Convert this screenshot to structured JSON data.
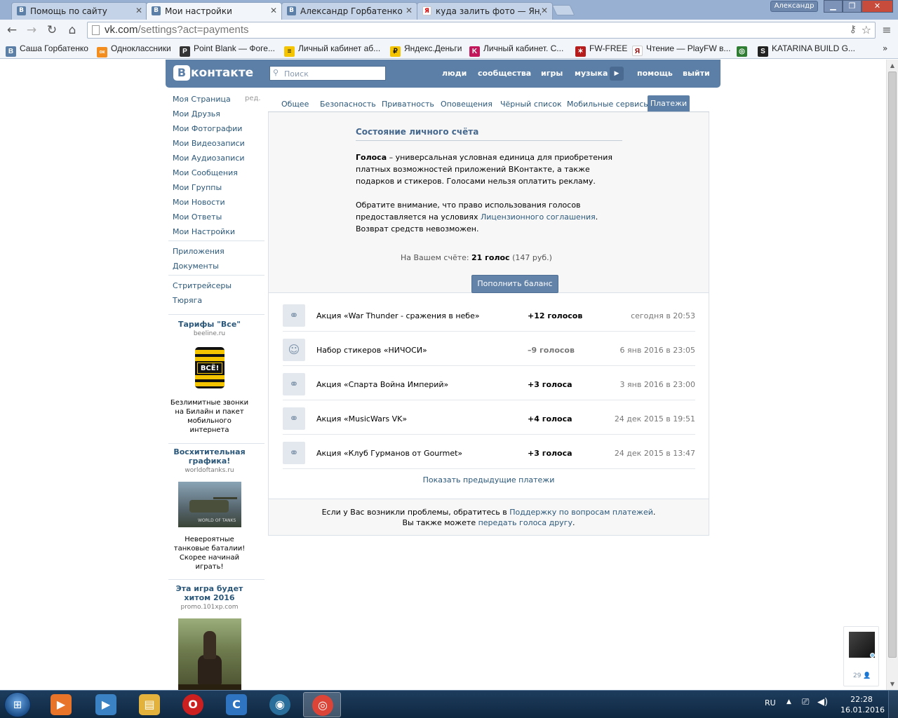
{
  "browser": {
    "tabs": [
      {
        "title": "Помощь по сайту",
        "favicon": "В",
        "kind": "vk"
      },
      {
        "title": "Мои настройки",
        "favicon": "В",
        "kind": "vk"
      },
      {
        "title": "Александр Горбатенко",
        "favicon": "В",
        "kind": "vk"
      },
      {
        "title": "куда залить фото — Янде",
        "favicon": "Я",
        "kind": "yandex"
      }
    ],
    "active_tab": 1,
    "window_user": "Александр",
    "url_host": "vk.com",
    "url_path": "/settings?act=payments",
    "bookmarks": [
      {
        "label": "Саша Горбатенко",
        "icon": "В",
        "color": "#5b7fa6"
      },
      {
        "label": "Одноклассники",
        "icon": "ок",
        "color": "#f28d1e"
      },
      {
        "label": "Point Blank — Фоге...",
        "icon": "P",
        "color": "#333333"
      },
      {
        "label": "Личный кабинет аб...",
        "icon": "≡",
        "color": "#f5c400"
      },
      {
        "label": "Яндекс.Деньги",
        "icon": "₽",
        "color": "#f5c400"
      },
      {
        "label": "Личный кабинет. С...",
        "icon": "K",
        "color": "#c2185b"
      },
      {
        "label": "FW-FREE",
        "icon": "✶",
        "color": "#b71c1c"
      },
      {
        "label": "Чтение — PlayFW в...",
        "icon": "Я",
        "color": "#8b0000"
      },
      {
        "label": "KATARINA BUILD G...",
        "icon": "◎",
        "color": "#2e7d32"
      },
      {
        "label": "",
        "icon": "S",
        "color": "#222222"
      }
    ],
    "bookmarks_more": "»"
  },
  "vk": {
    "logo_letter": "В",
    "logo_text": "контакте",
    "search_placeholder": "Поиск",
    "nav": {
      "people": "люди",
      "communities": "сообщества",
      "games": "игры",
      "music": "музыка",
      "help": "помощь",
      "logout": "выйти"
    }
  },
  "left_menu": {
    "edit": "ред.",
    "items": [
      "Моя Страница",
      "Мои Друзья",
      "Мои Фотографии",
      "Мои Видеозаписи",
      "Мои Аудиозаписи",
      "Мои Сообщения",
      "Мои Группы",
      "Мои Новости",
      "Мои Ответы",
      "Мои Настройки"
    ],
    "apps": [
      "Приложения",
      "Документы"
    ],
    "groups": [
      "Стритрейсеры",
      "Тюряга"
    ]
  },
  "ads": [
    {
      "title": "Тарифы \"Все\"",
      "domain": "beeline.ru",
      "image_text": "ВСЁ!",
      "text": "Безлимитные звонки на Билайн и пакет мобильного интернета"
    },
    {
      "title": "Восхитительная графика!",
      "domain": "worldoftanks.ru",
      "image_text": "WORLD OF TANKS",
      "text": "Невероятные танковые баталии! Скорее начинай играть!"
    },
    {
      "title": "Эта игра будет хитом 2016",
      "domain": "promo.101xp.com"
    }
  ],
  "settings_tabs": {
    "general": "Общее",
    "security": "Безопасность",
    "privacy": "Приватность",
    "notifications": "Оповещения",
    "blacklist": "Чёрный список",
    "mobile": "Мобильные сервисы",
    "payments": "Платежи"
  },
  "balance": {
    "title": "Состояние личного счёта",
    "p1_bold": "Голоса",
    "p1_rest": " – универсальная условная единица для приобретения платных возможностей приложений ВКонтакте, а также подарков и стикеров. Голосами нельзя оплатить рекламу.",
    "p2_start": "Обратите внимание, что право использования голосов предоставляется на условиях ",
    "p2_link": "Лицензионного соглашения",
    "p2_end": ". Возврат средств невозможен.",
    "label": "На Вашем счёте:",
    "votes": "21 голос",
    "rub": " (147 руб.)",
    "topup_button": "Пополнить баланс"
  },
  "payments": [
    {
      "icon": "candy-icon",
      "glyph": "⚭",
      "name": "Акция «War Thunder - сражения в небе»",
      "amount": "+12 голосов",
      "negative": false,
      "date": "сегодня в 20:53"
    },
    {
      "icon": "smile-icon",
      "glyph": "☺",
      "name": "Набор стикеров «НИЧОСИ»",
      "amount": "–9 голосов",
      "negative": true,
      "date": "6 янв 2016 в 23:05"
    },
    {
      "icon": "candy-icon",
      "glyph": "⚭",
      "name": "Акция «Спарта Война Империй»",
      "amount": "+3 голоса",
      "negative": false,
      "date": "3 янв 2016 в 23:00"
    },
    {
      "icon": "candy-icon",
      "glyph": "⚭",
      "name": "Акция «MusicWars VK»",
      "amount": "+4 голоса",
      "negative": false,
      "date": "24 дек 2015 в 19:51"
    },
    {
      "icon": "candy-icon",
      "glyph": "⚭",
      "name": "Акция «Клуб Гурманов от Gourmet»",
      "amount": "+3 голоса",
      "negative": false,
      "date": "24 дек 2015 в 13:47"
    }
  ],
  "show_previous": "Показать предыдущие платежи",
  "footer": {
    "l1_start": "Если у Вас возникли проблемы, обратитесь в ",
    "l1_link": "Поддержку по вопросам платежей",
    "l1_end": ".",
    "l2_start": "Вы также можете ",
    "l2_link": "передать голоса другу",
    "l2_end": "."
  },
  "chat": {
    "count": "29"
  },
  "taskbar": {
    "lang": "RU",
    "time": "22:28",
    "date": "16.01.2016",
    "apps": [
      {
        "name": "media-player",
        "glyph": "▶",
        "color": "#e8742a"
      },
      {
        "name": "video-app",
        "glyph": "▶",
        "color": "#3b82c4"
      },
      {
        "name": "explorer",
        "glyph": "▤",
        "color": "#e2b23c"
      },
      {
        "name": "opera",
        "glyph": "O",
        "color": "#cc1f1f"
      },
      {
        "name": "app-c",
        "glyph": "C",
        "color": "#2f74c0"
      },
      {
        "name": "app-steam",
        "glyph": "◉",
        "color": "#2a6f9b"
      },
      {
        "name": "chrome",
        "glyph": "◎",
        "color": "#db4437"
      }
    ]
  }
}
